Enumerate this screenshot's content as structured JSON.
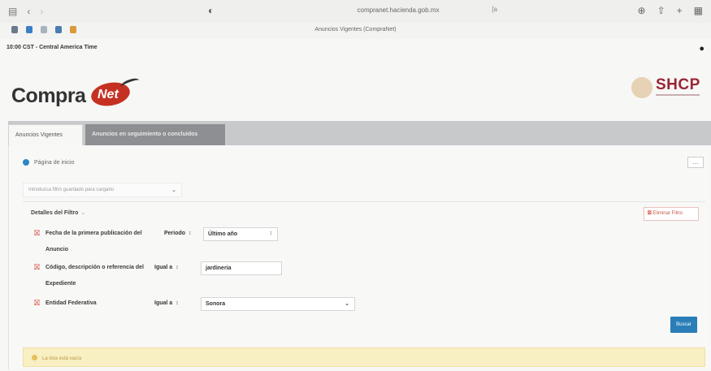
{
  "browser": {
    "url": "compranet.hacienda.gob.mx",
    "url_right": "[a",
    "tab_title": "Anuncios Vigentes (CompraNet)",
    "time": "10:00 CST - Central America Time"
  },
  "header": {
    "logo_compra": "Compra",
    "logo_net": "Net",
    "shcp": "SHCP"
  },
  "tabs": [
    {
      "label": "Anuncios Vigentes"
    },
    {
      "label": "Anuncios en seguimiento o concluidos"
    }
  ],
  "breadcrumb": {
    "label": "Página de inicio"
  },
  "more_button": "...",
  "saved_filter": {
    "placeholder": "Introduzca filtro guardado para cargarlo"
  },
  "filters": {
    "title": "Detalles del Filtro",
    "remove_label": "Eliminar Filtro",
    "rows": [
      {
        "label_line1": "Fecha de la primera publicación del",
        "label_line2": "Anuncio",
        "operator": "Periodo",
        "value": "Último año"
      },
      {
        "label_line1": "Código, descripción o referencia del",
        "label_line2": "Expediente",
        "operator": "Igual a",
        "value": "jardineria"
      },
      {
        "label_line1": "Entidad Federativa",
        "label_line2": "",
        "operator": "Igual a",
        "value": "Sonora"
      }
    ],
    "search_button": "Buscar"
  },
  "alert": {
    "text": "La lista está vacía"
  },
  "colors": {
    "accent": "#2a7eb8",
    "brand_red": "#c43122",
    "shcp": "#9a2533",
    "alert_bg": "#f8efc3"
  }
}
